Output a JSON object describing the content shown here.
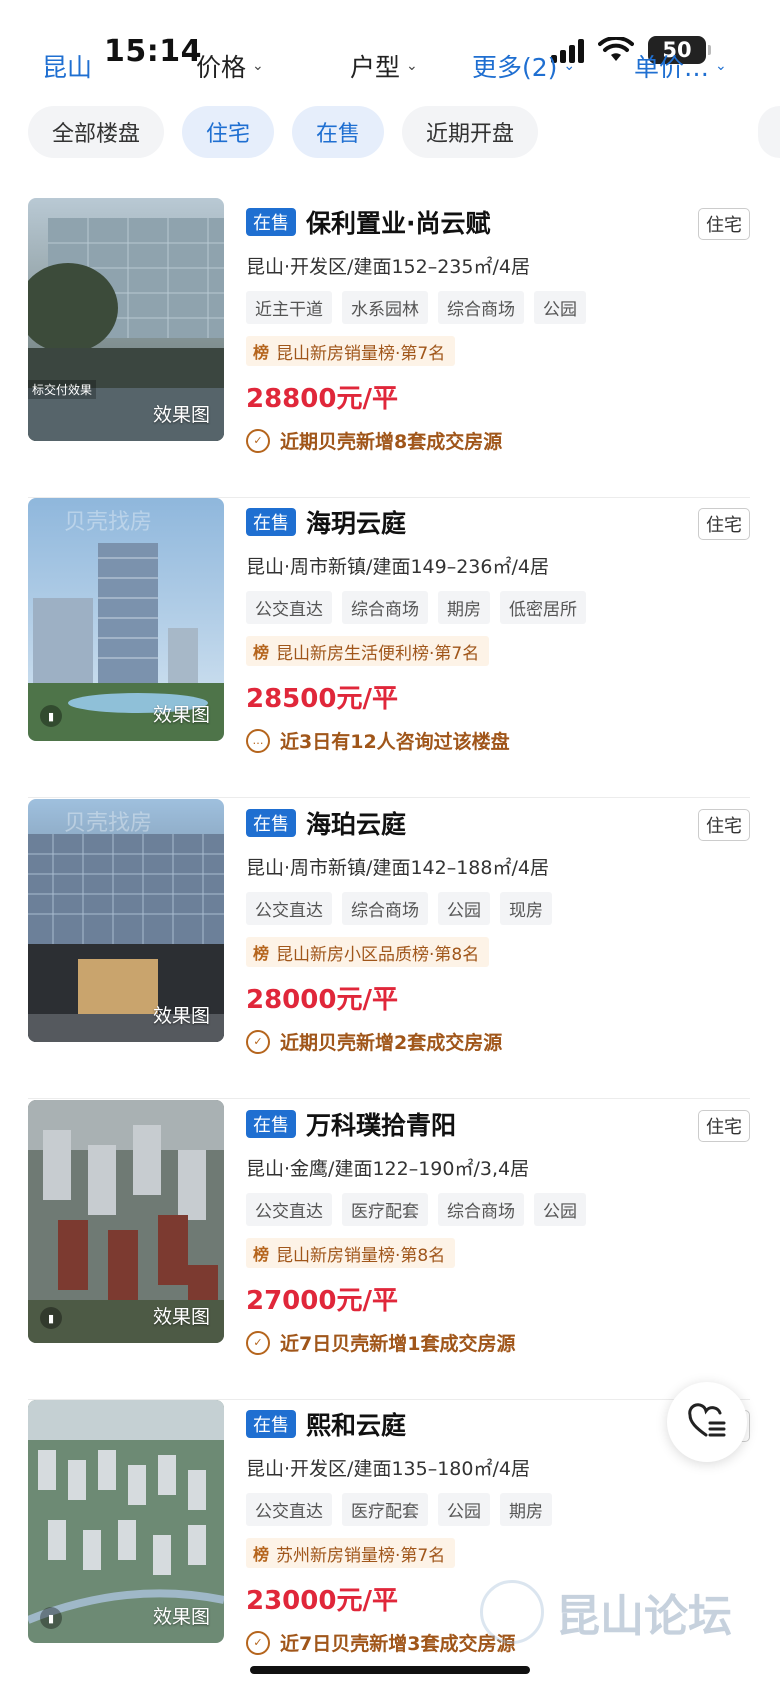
{
  "status_bar": {
    "time": "15:14",
    "battery": "50"
  },
  "filters": {
    "city": "昆山",
    "price": "价格",
    "layout": "户型",
    "more": "更多(2)",
    "sort": "单价…"
  },
  "chips": [
    "全部楼盘",
    "住宅",
    "在售",
    "近期开盘"
  ],
  "render_label": "效果图",
  "delivery_note": "标交付效果",
  "watermark": "贝壳找房",
  "listings": [
    {
      "status": "在售",
      "name": "保利置业·尚云赋",
      "type": "住宅",
      "meta": "昆山·开发区/建面152–235㎡/4居",
      "tags": [
        "近主干道",
        "水系园林",
        "综合商场",
        "公园"
      ],
      "rank_icon": "榜",
      "rank": "昆山新房销量榜·第7名",
      "price": "28800元/平",
      "highlight_icon": "deal-icon",
      "highlight": "近期贝壳新增8套成交房源"
    },
    {
      "status": "在售",
      "name": "海玥云庭",
      "type": "住宅",
      "meta": "昆山·周市新镇/建面149–236㎡/4居",
      "tags": [
        "公交直达",
        "综合商场",
        "期房",
        "低密居所"
      ],
      "rank_icon": "榜",
      "rank": "昆山新房生活便利榜·第7名",
      "price": "28500元/平",
      "highlight_icon": "chat-icon",
      "highlight": "近3日有12人咨询过该楼盘"
    },
    {
      "status": "在售",
      "name": "海珀云庭",
      "type": "住宅",
      "meta": "昆山·周市新镇/建面142–188㎡/4居",
      "tags": [
        "公交直达",
        "综合商场",
        "公园",
        "现房"
      ],
      "rank_icon": "榜",
      "rank": "昆山新房小区品质榜·第8名",
      "price": "28000元/平",
      "highlight_icon": "deal-icon",
      "highlight": "近期贝壳新增2套成交房源"
    },
    {
      "status": "在售",
      "name": "万科璞拾青阳",
      "type": "住宅",
      "meta": "昆山·金鹰/建面122–190㎡/3,4居",
      "tags": [
        "公交直达",
        "医疗配套",
        "综合商场",
        "公园"
      ],
      "rank_icon": "榜",
      "rank": "昆山新房销量榜·第8名",
      "price": "27000元/平",
      "highlight_icon": "deal-icon",
      "highlight": "近7日贝壳新增1套成交房源"
    },
    {
      "status": "在售",
      "name": "熙和云庭",
      "type": "住宅",
      "meta": "昆山·开发区/建面135–180㎡/4居",
      "tags": [
        "公交直达",
        "医疗配套",
        "公园",
        "期房"
      ],
      "rank_icon": "榜",
      "rank": "苏州新房销量榜·第7名",
      "price": "23000元/平",
      "highlight_icon": "deal-icon",
      "highlight": "近7日贝壳新增3套成交房源"
    }
  ],
  "forum_watermark": "昆山论坛",
  "colors": {
    "accent": "#1f6fd1",
    "price": "#e0273a",
    "rank": "#a0561a"
  }
}
